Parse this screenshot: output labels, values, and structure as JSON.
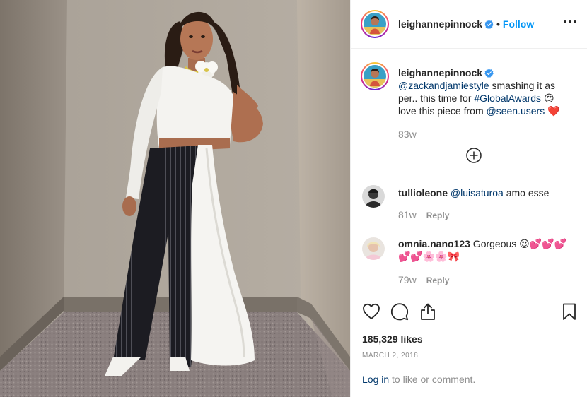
{
  "post": {
    "username": "leighannepinnock",
    "follow_label": "Follow",
    "dot": "•"
  },
  "caption": {
    "username": "leighannepinnock",
    "mention1": "@zackandjamiestyle",
    "text1": " smashing it as per.. this time for ",
    "hashtag": "#GlobalAwards",
    "emoji1": " 😍 ",
    "text2": "love this piece from ",
    "mention2": "@seen.users",
    "emoji2": " ❤️",
    "time": "83w"
  },
  "comments": [
    {
      "username": "tullioleone",
      "mention": "@luisaturoa",
      "text": " amo esse",
      "time": "81w",
      "reply_label": "Reply"
    },
    {
      "username": "omnia.nano123",
      "text": " Gorgeous 😍💕💕💕💕💕🌸🌸🎀",
      "time": "79w",
      "reply_label": "Reply"
    }
  ],
  "actions": {
    "likes": "185,329 likes",
    "date": "MARCH 2, 2018"
  },
  "login": {
    "link": "Log in",
    "rest": " to like or comment."
  },
  "icons": [
    "verified-badge-icon",
    "more-options-icon",
    "load-more-icon",
    "heart-icon",
    "comment-icon",
    "share-icon",
    "bookmark-icon"
  ],
  "colors": {
    "accent": "#0095f6",
    "link": "#00376b",
    "muted": "#8e8e8e",
    "text": "#262626"
  }
}
